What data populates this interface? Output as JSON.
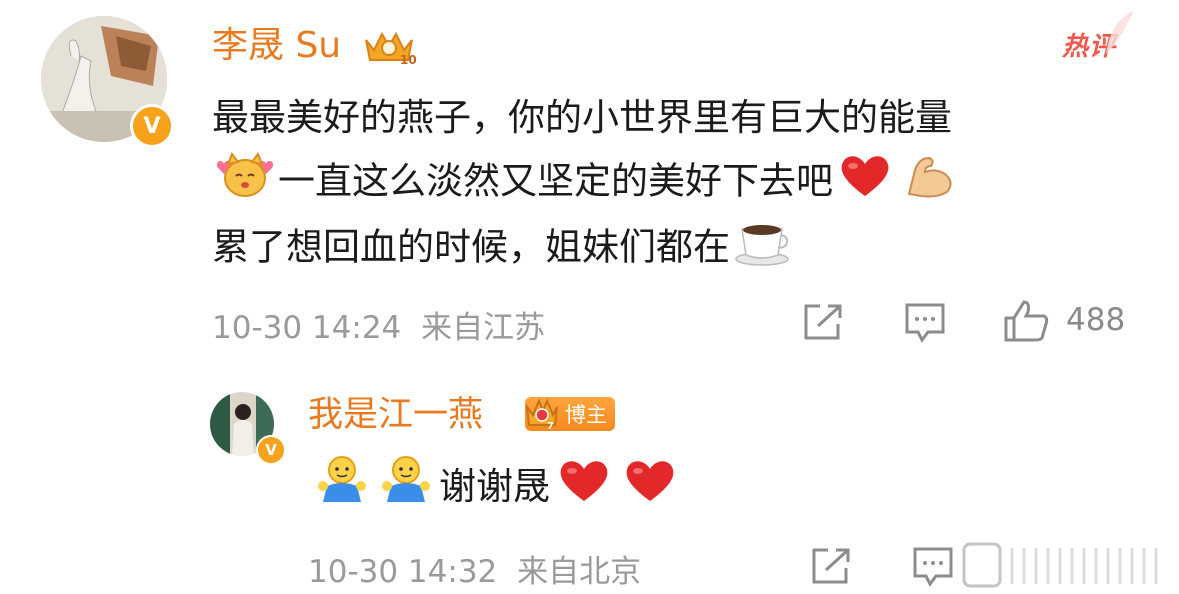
{
  "comment": {
    "author": "李晟 Su",
    "tag": "热评",
    "lines": [
      "最最美好的燕子，你的小世界里有巨大的能量",
      "一直这么淡然又坚定的美好下去吧",
      "累了想回血的时候，姐妹们都在"
    ],
    "time": "10-30 14:24",
    "source": "来自江苏",
    "like_count": "488"
  },
  "reply": {
    "author": "我是江一燕",
    "badge": "博主",
    "text": "谢谢晟",
    "time": "10-30 14:32",
    "source": "来自北京"
  },
  "colors": {
    "name": "#e97a1f",
    "hot_tag": "#f05a4d",
    "meta": "#9a9a9a",
    "vip_badge": "#f7a21b"
  },
  "icons": [
    "share-icon",
    "comment-icon",
    "like-icon",
    "heart-emoji",
    "muscle-emoji",
    "coffee-emoji",
    "blush-emoji",
    "hug-emoji"
  ]
}
